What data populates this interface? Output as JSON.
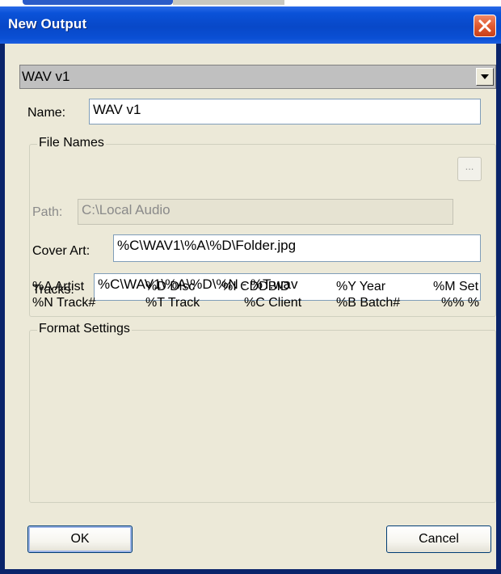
{
  "window": {
    "title": "New Output"
  },
  "preset": {
    "selected": "WAV v1"
  },
  "form": {
    "name_label": "Name:",
    "name_value": "WAV v1",
    "file_names": {
      "legend": "File Names",
      "path_label": "Path:",
      "path_value": "C:\\Local Audio",
      "browse_label": "...",
      "cover_art_label": "Cover Art:",
      "cover_art_value": "%C\\WAV1\\%A\\%D\\Folder.jpg",
      "tracks_label": "Tracks:",
      "tracks_value": "%C\\WAV1\\%A\\%D\\%N - %T.wav"
    },
    "tokens_row1": [
      "%A Artist",
      "%D Disc",
      "%I CDDBID",
      "%Y Year",
      "%M Set"
    ],
    "tokens_row2": [
      "%N Track#",
      "%T Track",
      "%C Client",
      "%B Batch#",
      "%% %"
    ],
    "format_settings": {
      "legend": "Format Settings"
    }
  },
  "buttons": {
    "ok": "OK",
    "cancel": "Cancel"
  },
  "colors": {
    "titlebar": "#0a52d8",
    "dialog_bg": "#ece9d8",
    "close": "#e05a30"
  }
}
